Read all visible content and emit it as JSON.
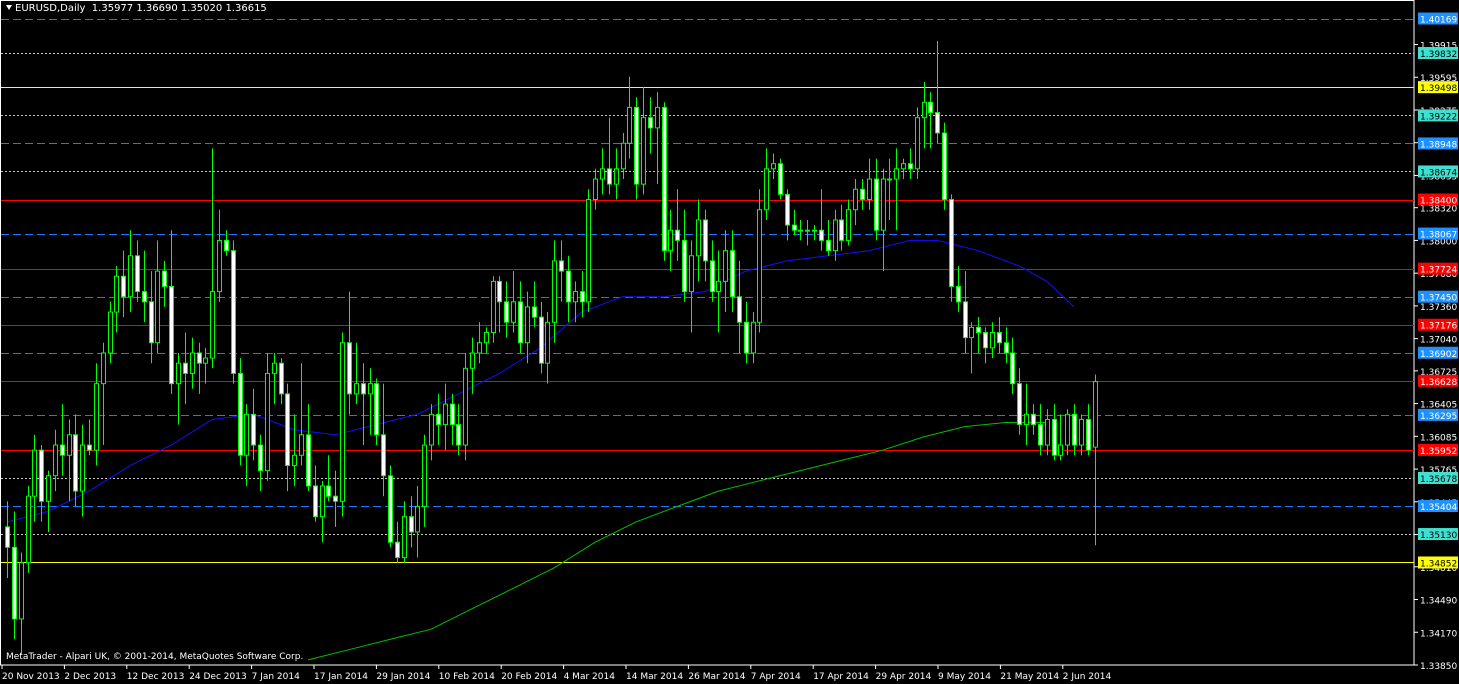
{
  "header": {
    "symbol": "EURUSD,Daily",
    "open": "1.35977",
    "high": "1.36690",
    "low": "1.35020",
    "close": "1.36615"
  },
  "footer": {
    "copyright": "MetaTrader - Alpari UK, © 2001-2014, MetaQuotes Software Corp."
  },
  "colors": {
    "background": "#000000",
    "candle": "#00ff00",
    "bull_body": "#000000",
    "bear_body": "#ffffff",
    "axis": "#ffffff",
    "ma_fast": "#1010ff",
    "ma_slow": "#00c000",
    "level_red": "#ff0000",
    "level_blue": "#1e78ff",
    "level_yellow": "#ffff00",
    "level_white": "#c8c8c8",
    "tag_red": "#ff0000",
    "tag_blue": "#1e90ff",
    "tag_cyan": "#40e0d0",
    "tag_yellow": "#ffff00"
  },
  "chart_data": {
    "type": "candlestick",
    "ylim": [
      1.3385,
      1.4035
    ],
    "x_labels": [
      "20 Nov 2013",
      "2 Dec 2013",
      "12 Dec 2013",
      "24 Dec 2013",
      "7 Jan 2014",
      "17 Jan 2014",
      "29 Jan 2014",
      "10 Feb 2014",
      "20 Feb 2014",
      "4 Mar 2014",
      "14 Mar 2014",
      "26 Mar 2014",
      "7 Apr 2014",
      "17 Apr 2014",
      "29 Apr 2014",
      "9 May 2014",
      "21 May 2014",
      "2 Jun 2014"
    ],
    "y_ticks": [
      "1.39915",
      "1.39595",
      "1.39275",
      "1.38955",
      "1.38635",
      "1.38320",
      "1.38000",
      "1.37680",
      "1.37360",
      "1.37040",
      "1.36725",
      "1.36405",
      "1.36085",
      "1.35765",
      "1.35445",
      "1.35125",
      "1.34810",
      "1.34490",
      "1.34170",
      "1.33850"
    ],
    "levels": [
      {
        "price": 1.40169,
        "label": "1.40169",
        "style": "dashed",
        "color": "blue",
        "tag": "blue"
      },
      {
        "price": 1.39832,
        "label": "1.39832",
        "style": "dotted",
        "color": "white",
        "tag": "cyan"
      },
      {
        "price": 1.39498,
        "label": "1.39498",
        "style": "solid",
        "color": "yellow",
        "tag": "yellow"
      },
      {
        "price": 1.39222,
        "label": "1.39222",
        "style": "dotted",
        "color": "white",
        "tag": "cyan"
      },
      {
        "price": 1.38948,
        "label": "1.38948",
        "style": "dashed",
        "color": "blue",
        "tag": "blue"
      },
      {
        "price": 1.38674,
        "label": "1.38674",
        "style": "dotted",
        "color": "white",
        "tag": "cyan"
      },
      {
        "price": 1.384,
        "label": "1.38400",
        "style": "solid",
        "color": "red",
        "tag": "red"
      },
      {
        "price": 1.38067,
        "label": "1.38067",
        "style": "dashed",
        "color": "blue",
        "tag": "blue"
      },
      {
        "price": 1.37724,
        "label": "1.37724",
        "style": "solid",
        "color": "red",
        "tag": "red"
      },
      {
        "price": 1.3745,
        "label": "1.37450",
        "style": "dashed",
        "color": "blue",
        "tag": "blue"
      },
      {
        "price": 1.37176,
        "label": "1.37176",
        "style": "solid",
        "color": "red",
        "tag": "red"
      },
      {
        "price": 1.36902,
        "label": "1.36902",
        "style": "dashed",
        "color": "blue",
        "tag": "blue"
      },
      {
        "price": 1.36628,
        "label": "1.36628",
        "style": "solid",
        "color": "red",
        "tag": "red"
      },
      {
        "price": 1.36295,
        "label": "1.36295",
        "style": "dashed",
        "color": "blue",
        "tag": "blue"
      },
      {
        "price": 1.35952,
        "label": "1.35952",
        "style": "solid",
        "color": "red",
        "tag": "red"
      },
      {
        "price": 1.35678,
        "label": "1.35678",
        "style": "dotted",
        "color": "white",
        "tag": "cyan"
      },
      {
        "price": 1.35404,
        "label": "1.35404",
        "style": "dashed",
        "color": "blue",
        "tag": "blue"
      },
      {
        "price": 1.3513,
        "label": "1.35130",
        "style": "dotted",
        "color": "white",
        "tag": "cyan"
      },
      {
        "price": 1.34852,
        "label": "1.34852",
        "style": "solid",
        "color": "yellow",
        "tag": "yellow"
      }
    ],
    "ohlc": [
      [
        1.352,
        1.3545,
        1.347,
        1.35
      ],
      [
        1.35,
        1.3535,
        1.341,
        1.343
      ],
      [
        1.343,
        1.3495,
        1.3395,
        1.3485
      ],
      [
        1.3485,
        1.356,
        1.3475,
        1.355
      ],
      [
        1.355,
        1.361,
        1.3525,
        1.3595
      ],
      [
        1.3595,
        1.36,
        1.3525,
        1.3545
      ],
      [
        1.3545,
        1.3575,
        1.3515,
        1.357
      ],
      [
        1.357,
        1.3615,
        1.3555,
        1.36
      ],
      [
        1.36,
        1.364,
        1.357,
        1.359
      ],
      [
        1.359,
        1.3625,
        1.3545,
        1.361
      ],
      [
        1.361,
        1.363,
        1.354,
        1.3555
      ],
      [
        1.3555,
        1.362,
        1.353,
        1.36
      ],
      [
        1.36,
        1.3625,
        1.359,
        1.3595
      ],
      [
        1.3595,
        1.368,
        1.358,
        1.366
      ],
      [
        1.366,
        1.37,
        1.36,
        1.369
      ],
      [
        1.369,
        1.374,
        1.368,
        1.373
      ],
      [
        1.373,
        1.3775,
        1.371,
        1.3765
      ],
      [
        1.3765,
        1.379,
        1.3725,
        1.3745
      ],
      [
        1.3745,
        1.381,
        1.373,
        1.3785
      ],
      [
        1.3785,
        1.38,
        1.374,
        1.375
      ],
      [
        1.375,
        1.379,
        1.372,
        1.374
      ],
      [
        1.374,
        1.377,
        1.368,
        1.37
      ],
      [
        1.37,
        1.38,
        1.369,
        1.377
      ],
      [
        1.377,
        1.378,
        1.3735,
        1.3755
      ],
      [
        1.3755,
        1.381,
        1.365,
        1.366
      ],
      [
        1.366,
        1.369,
        1.362,
        1.368
      ],
      [
        1.368,
        1.371,
        1.364,
        1.367
      ],
      [
        1.367,
        1.3705,
        1.3655,
        1.369
      ],
      [
        1.369,
        1.37,
        1.365,
        1.368
      ],
      [
        1.368,
        1.3695,
        1.366,
        1.3685
      ],
      [
        1.3685,
        1.389,
        1.3675,
        1.375
      ],
      [
        1.375,
        1.383,
        1.374,
        1.38
      ],
      [
        1.38,
        1.381,
        1.3785,
        1.379
      ],
      [
        1.379,
        1.38,
        1.366,
        1.367
      ],
      [
        1.367,
        1.3685,
        1.358,
        1.359
      ],
      [
        1.359,
        1.364,
        1.356,
        1.363
      ],
      [
        1.363,
        1.3655,
        1.3585,
        1.36
      ],
      [
        1.36,
        1.361,
        1.3555,
        1.3575
      ],
      [
        1.3575,
        1.369,
        1.3565,
        1.367
      ],
      [
        1.367,
        1.369,
        1.364,
        1.368
      ],
      [
        1.368,
        1.3685,
        1.364,
        1.365
      ],
      [
        1.365,
        1.366,
        1.3555,
        1.358
      ],
      [
        1.358,
        1.363,
        1.356,
        1.359
      ],
      [
        1.359,
        1.368,
        1.358,
        1.361
      ],
      [
        1.361,
        1.364,
        1.3555,
        1.356
      ],
      [
        1.356,
        1.358,
        1.3525,
        1.353
      ],
      [
        1.353,
        1.3565,
        1.3505,
        1.356
      ],
      [
        1.356,
        1.359,
        1.3545,
        1.355
      ],
      [
        1.355,
        1.3575,
        1.352,
        1.3545
      ],
      [
        1.3545,
        1.371,
        1.353,
        1.37
      ],
      [
        1.37,
        1.375,
        1.363,
        1.365
      ],
      [
        1.365,
        1.37,
        1.364,
        1.366
      ],
      [
        1.366,
        1.368,
        1.36,
        1.365
      ],
      [
        1.365,
        1.3675,
        1.361,
        1.366
      ],
      [
        1.366,
        1.3665,
        1.36,
        1.361
      ],
      [
        1.361,
        1.366,
        1.355,
        1.357
      ],
      [
        1.357,
        1.358,
        1.35,
        1.3505
      ],
      [
        1.3505,
        1.3525,
        1.3485,
        1.349
      ],
      [
        1.349,
        1.3545,
        1.3485,
        1.353
      ],
      [
        1.353,
        1.355,
        1.35,
        1.3515
      ],
      [
        1.3515,
        1.356,
        1.349,
        1.354
      ],
      [
        1.354,
        1.361,
        1.352,
        1.36
      ],
      [
        1.36,
        1.364,
        1.3585,
        1.363
      ],
      [
        1.363,
        1.365,
        1.36,
        1.362
      ],
      [
        1.362,
        1.366,
        1.3595,
        1.364
      ],
      [
        1.364,
        1.365,
        1.36,
        1.362
      ],
      [
        1.362,
        1.364,
        1.359,
        1.36
      ],
      [
        1.36,
        1.369,
        1.3585,
        1.3675
      ],
      [
        1.3675,
        1.3705,
        1.365,
        1.369
      ],
      [
        1.369,
        1.372,
        1.368,
        1.37
      ],
      [
        1.37,
        1.3715,
        1.369,
        1.371
      ],
      [
        1.371,
        1.3765,
        1.37,
        1.376
      ],
      [
        1.376,
        1.3765,
        1.371,
        1.374
      ],
      [
        1.374,
        1.376,
        1.3705,
        1.372
      ],
      [
        1.372,
        1.377,
        1.371,
        1.374
      ],
      [
        1.374,
        1.376,
        1.369,
        1.37
      ],
      [
        1.37,
        1.375,
        1.368,
        1.3735
      ],
      [
        1.3735,
        1.376,
        1.3715,
        1.3725
      ],
      [
        1.3725,
        1.374,
        1.367,
        1.368
      ],
      [
        1.368,
        1.373,
        1.366,
        1.372
      ],
      [
        1.372,
        1.38,
        1.37,
        1.378
      ],
      [
        1.378,
        1.38,
        1.374,
        1.377
      ],
      [
        1.377,
        1.3785,
        1.372,
        1.374
      ],
      [
        1.374,
        1.376,
        1.372,
        1.375
      ],
      [
        1.375,
        1.377,
        1.3725,
        1.374
      ],
      [
        1.374,
        1.385,
        1.373,
        1.384
      ],
      [
        1.384,
        1.387,
        1.383,
        1.386
      ],
      [
        1.386,
        1.389,
        1.3845,
        1.387
      ],
      [
        1.387,
        1.392,
        1.3845,
        1.3855
      ],
      [
        1.3855,
        1.389,
        1.384,
        1.387
      ],
      [
        1.387,
        1.3905,
        1.386,
        1.3895
      ],
      [
        1.3895,
        1.396,
        1.388,
        1.393
      ],
      [
        1.393,
        1.394,
        1.384,
        1.3855
      ],
      [
        1.3855,
        1.395,
        1.3845,
        1.392
      ],
      [
        1.392,
        1.394,
        1.3885,
        1.391
      ],
      [
        1.391,
        1.3945,
        1.3855,
        1.393
      ],
      [
        1.393,
        1.3935,
        1.378,
        1.379
      ],
      [
        1.379,
        1.383,
        1.377,
        1.381
      ],
      [
        1.381,
        1.385,
        1.378,
        1.38
      ],
      [
        1.38,
        1.383,
        1.374,
        1.375
      ],
      [
        1.375,
        1.38,
        1.371,
        1.3785
      ],
      [
        1.3785,
        1.384,
        1.376,
        1.382
      ],
      [
        1.382,
        1.383,
        1.376,
        1.378
      ],
      [
        1.378,
        1.38,
        1.374,
        1.375
      ],
      [
        1.375,
        1.379,
        1.371,
        1.376
      ],
      [
        1.376,
        1.381,
        1.373,
        1.379
      ],
      [
        1.379,
        1.381,
        1.373,
        1.3745
      ],
      [
        1.3745,
        1.378,
        1.369,
        1.372
      ],
      [
        1.372,
        1.374,
        1.368,
        1.369
      ],
      [
        1.369,
        1.373,
        1.368,
        1.372
      ],
      [
        1.372,
        1.385,
        1.371,
        1.383
      ],
      [
        1.383,
        1.389,
        1.382,
        1.387
      ],
      [
        1.387,
        1.3885,
        1.386,
        1.3875
      ],
      [
        1.3875,
        1.388,
        1.384,
        1.3845
      ],
      [
        1.3845,
        1.385,
        1.38,
        1.3815
      ],
      [
        1.3815,
        1.383,
        1.3805,
        1.381
      ],
      [
        1.381,
        1.382,
        1.38,
        1.381
      ],
      [
        1.381,
        1.382,
        1.3795,
        1.381
      ],
      [
        1.381,
        1.3815,
        1.38,
        1.381
      ],
      [
        1.381,
        1.385,
        1.379,
        1.38
      ],
      [
        1.38,
        1.382,
        1.3785,
        1.379
      ],
      [
        1.379,
        1.383,
        1.378,
        1.382
      ],
      [
        1.382,
        1.3835,
        1.379,
        1.38
      ],
      [
        1.38,
        1.384,
        1.3795,
        1.383
      ],
      [
        1.383,
        1.386,
        1.3815,
        1.385
      ],
      [
        1.385,
        1.386,
        1.383,
        1.384
      ],
      [
        1.384,
        1.388,
        1.383,
        1.386
      ],
      [
        1.386,
        1.388,
        1.38,
        1.381
      ],
      [
        1.381,
        1.387,
        1.377,
        1.386
      ],
      [
        1.386,
        1.388,
        1.382,
        1.386
      ],
      [
        1.386,
        1.389,
        1.381,
        1.387
      ],
      [
        1.387,
        1.388,
        1.386,
        1.3875
      ],
      [
        1.3875,
        1.389,
        1.386,
        1.387
      ],
      [
        1.387,
        1.393,
        1.386,
        1.392
      ],
      [
        1.392,
        1.3955,
        1.389,
        1.3935
      ],
      [
        1.3935,
        1.3945,
        1.389,
        1.3925
      ],
      [
        1.3925,
        1.3995,
        1.3895,
        1.3905
      ],
      [
        1.3905,
        1.3915,
        1.383,
        1.384
      ],
      [
        1.384,
        1.3845,
        1.374,
        1.3755
      ],
      [
        1.3755,
        1.3775,
        1.373,
        1.374
      ],
      [
        1.374,
        1.377,
        1.369,
        1.3705
      ],
      [
        1.3705,
        1.372,
        1.367,
        1.3715
      ],
      [
        1.3715,
        1.3725,
        1.369,
        1.371
      ],
      [
        1.371,
        1.3715,
        1.368,
        1.3695
      ],
      [
        1.3695,
        1.372,
        1.3685,
        1.371
      ],
      [
        1.371,
        1.3725,
        1.369,
        1.37
      ],
      [
        1.37,
        1.3715,
        1.368,
        1.369
      ],
      [
        1.369,
        1.3705,
        1.365,
        1.366
      ],
      [
        1.366,
        1.3675,
        1.361,
        1.362
      ],
      [
        1.362,
        1.366,
        1.36,
        1.363
      ],
      [
        1.363,
        1.364,
        1.361,
        1.362
      ],
      [
        1.362,
        1.364,
        1.359,
        1.36
      ],
      [
        1.36,
        1.3635,
        1.359,
        1.3625
      ],
      [
        1.3625,
        1.364,
        1.3585,
        1.359
      ],
      [
        1.359,
        1.363,
        1.3585,
        1.36
      ],
      [
        1.36,
        1.3635,
        1.359,
        1.363
      ],
      [
        1.363,
        1.364,
        1.359,
        1.36
      ],
      [
        1.36,
        1.363,
        1.359,
        1.3625
      ],
      [
        1.3625,
        1.364,
        1.359,
        1.3595
      ],
      [
        1.3598,
        1.3669,
        1.3502,
        1.3662
      ]
    ],
    "ma_fast": [
      [
        0,
        1.3525
      ],
      [
        6,
        1.3535
      ],
      [
        12,
        1.3555
      ],
      [
        18,
        1.358
      ],
      [
        24,
        1.36
      ],
      [
        30,
        1.3625
      ],
      [
        36,
        1.363
      ],
      [
        42,
        1.3615
      ],
      [
        48,
        1.361
      ],
      [
        54,
        1.362
      ],
      [
        60,
        1.363
      ],
      [
        66,
        1.365
      ],
      [
        72,
        1.367
      ],
      [
        78,
        1.3695
      ],
      [
        84,
        1.373
      ],
      [
        90,
        1.3745
      ],
      [
        96,
        1.3745
      ],
      [
        102,
        1.375
      ],
      [
        108,
        1.377
      ],
      [
        114,
        1.378
      ],
      [
        120,
        1.3785
      ],
      [
        126,
        1.379
      ],
      [
        132,
        1.38
      ],
      [
        136,
        1.38
      ],
      [
        142,
        1.379
      ],
      [
        148,
        1.3775
      ],
      [
        152,
        1.376
      ],
      [
        156,
        1.3735
      ]
    ],
    "ma_slow": [
      [
        44,
        1.339
      ],
      [
        50,
        1.34
      ],
      [
        56,
        1.341
      ],
      [
        62,
        1.342
      ],
      [
        68,
        1.344
      ],
      [
        74,
        1.346
      ],
      [
        80,
        1.348
      ],
      [
        86,
        1.3505
      ],
      [
        92,
        1.3525
      ],
      [
        98,
        1.354
      ],
      [
        104,
        1.3555
      ],
      [
        110,
        1.3565
      ],
      [
        116,
        1.3575
      ],
      [
        122,
        1.3585
      ],
      [
        128,
        1.3595
      ],
      [
        134,
        1.3608
      ],
      [
        140,
        1.3618
      ],
      [
        146,
        1.3622
      ],
      [
        152,
        1.3622
      ]
    ]
  }
}
